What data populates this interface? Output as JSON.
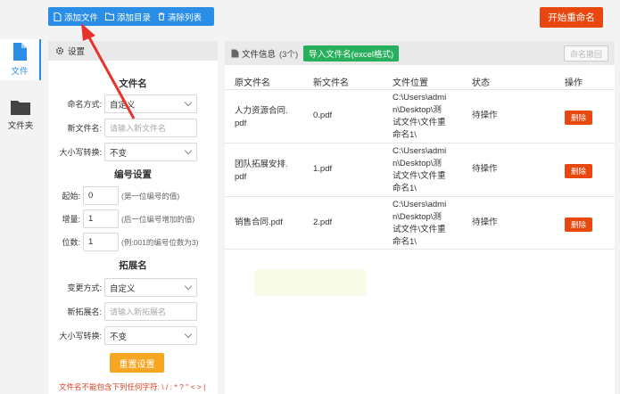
{
  "toolbar": {
    "add_file": "添加文件",
    "add_dir": "添加目录",
    "clear_list": "清除列表",
    "start": "开始重命名"
  },
  "sidenav": {
    "file": "文件",
    "folder": "文件夹"
  },
  "settings": {
    "header": "设置",
    "filename_title": "文件名",
    "naming_label": "命名方式:",
    "naming_value": "自定义",
    "newname_label": "新文件名:",
    "newname_placeholder": "请输入新文件名",
    "case_label": "大小写转换:",
    "case_value": "不变",
    "numbering_title": "编号设置",
    "start_label": "起始:",
    "start_value": "0",
    "start_hint": "(第一位编号的值)",
    "inc_label": "增量:",
    "inc_value": "1",
    "inc_hint": "(后一位编号增加的值)",
    "digits_label": "位数:",
    "digits_value": "1",
    "digits_hint": "(例:001的编号位数为3)",
    "ext_title": "拓展名",
    "ext_mode_label": "变更方式:",
    "ext_mode_value": "自定义",
    "new_ext_label": "新拓展名:",
    "new_ext_placeholder": "请输入新拓展名",
    "ext_case_label": "大小写转换:",
    "ext_case_value": "不变",
    "reset": "重置设置",
    "warning": "文件名不能包含下列任何字符: \\ / : * ? \" < > |"
  },
  "main": {
    "info_label": "文件信息",
    "count": "(3个)",
    "import_btn": "导入文件名(excel格式)",
    "rename_btn": "命名撤回",
    "columns": [
      "原文件名",
      "新文件名",
      "文件位置",
      "状态",
      "操作"
    ],
    "rows": [
      {
        "orig1": "人力资源合同.",
        "orig2": "pdf",
        "new": "0.pdf",
        "loc1": "C:\\Users\\admi",
        "loc2": "n\\Desktop\\测",
        "loc3": "试文件\\文件重",
        "loc4": "命名1\\",
        "status": "待操作",
        "action": "删除"
      },
      {
        "orig1": "团队拓展安排.",
        "orig2": "pdf",
        "new": "1.pdf",
        "loc1": "C:\\Users\\admi",
        "loc2": "n\\Desktop\\测",
        "loc3": "试文件\\文件重",
        "loc4": "命名1\\",
        "status": "待操作",
        "action": "删除"
      },
      {
        "orig1": "销售合同.pdf",
        "orig2": "",
        "new": "2.pdf",
        "loc1": "C:\\Users\\admi",
        "loc2": "n\\Desktop\\测",
        "loc3": "试文件\\文件重",
        "loc4": "命名1\\",
        "status": "待操作",
        "action": "删除"
      }
    ]
  },
  "colors": {
    "primary": "#2b8ee6",
    "danger": "#e8470f",
    "success": "#27b05c",
    "warn_btn": "#f6a623",
    "arrow": "#e8322c"
  }
}
